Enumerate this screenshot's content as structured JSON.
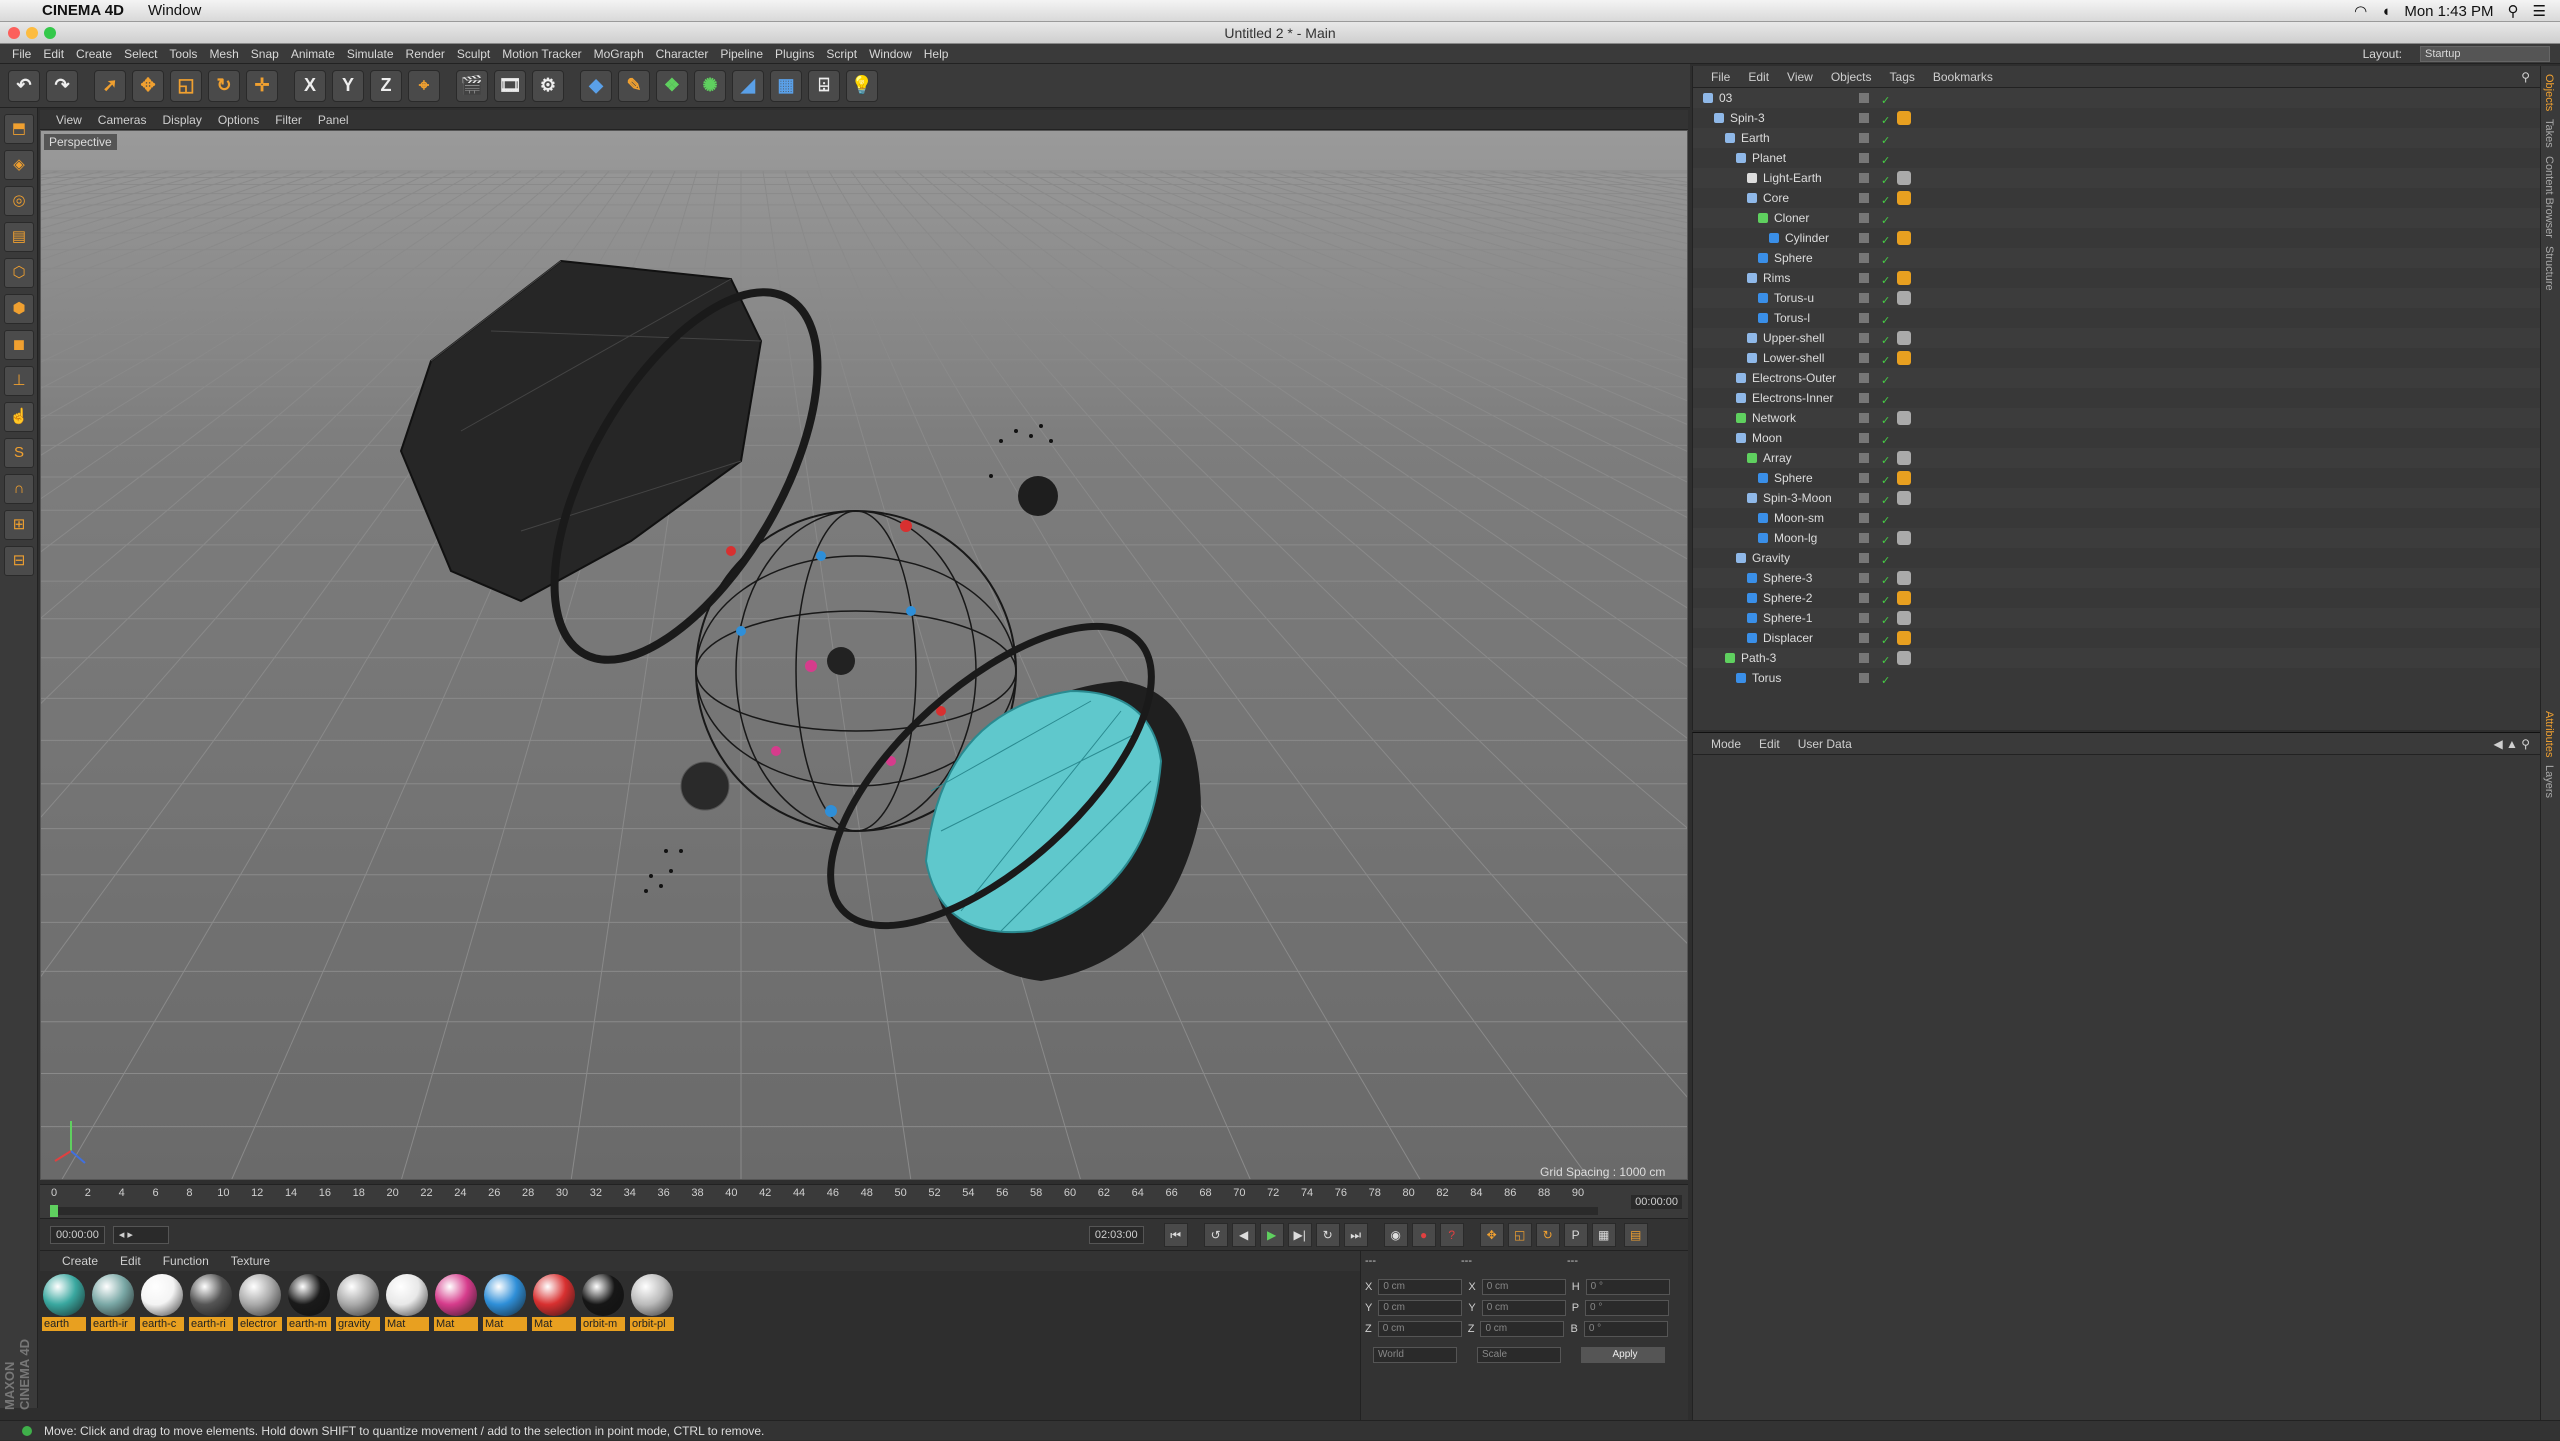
{
  "mac_menubar": {
    "app_name": "CINEMA 4D",
    "menus": [
      "Window"
    ],
    "clock": "Mon 1:43 PM"
  },
  "window": {
    "title": "Untitled 2 * - Main"
  },
  "main_menu": {
    "items": [
      "File",
      "Edit",
      "Create",
      "Select",
      "Tools",
      "Mesh",
      "Snap",
      "Animate",
      "Simulate",
      "Render",
      "Sculpt",
      "Motion Tracker",
      "MoGraph",
      "Character",
      "Pipeline",
      "Plugins",
      "Script",
      "Window",
      "Help"
    ],
    "layout_label": "Layout:",
    "layout_value": "Startup"
  },
  "toolbar": {
    "axis_x": "X",
    "axis_y": "Y",
    "axis_z": "Z"
  },
  "viewport": {
    "menu": [
      "View",
      "Cameras",
      "Display",
      "Options",
      "Filter",
      "Panel"
    ],
    "label": "Perspective",
    "grid_spacing": "Grid Spacing : 1000 cm"
  },
  "timeline": {
    "ticks": [
      "0",
      "2",
      "4",
      "6",
      "8",
      "10",
      "12",
      "14",
      "16",
      "18",
      "20",
      "22",
      "24",
      "26",
      "28",
      "30",
      "32",
      "34",
      "36",
      "38",
      "40",
      "42",
      "44",
      "46",
      "48",
      "50",
      "52",
      "54",
      "56",
      "58",
      "60",
      "62",
      "64",
      "66",
      "68",
      "70",
      "72",
      "74",
      "76",
      "78",
      "80",
      "82",
      "84",
      "86",
      "88",
      "90"
    ],
    "end_field": "00:00:00"
  },
  "transport": {
    "current_time": "00:00:00",
    "end_time": "02:03:00"
  },
  "materials": {
    "menu": [
      "Create",
      "Edit",
      "Function",
      "Texture"
    ],
    "items": [
      {
        "label": "earth",
        "color": "#3aa8a0"
      },
      {
        "label": "earth-ir",
        "color": "#7aa8a6"
      },
      {
        "label": "earth-c",
        "color": "#f4f4f4"
      },
      {
        "label": "earth-ri",
        "color": "#555555"
      },
      {
        "label": "electror",
        "color": "#aaaaaa"
      },
      {
        "label": "earth-m",
        "color": "#1a1a1a"
      },
      {
        "label": "gravity",
        "color": "#aaaaaa"
      },
      {
        "label": "Mat",
        "color": "#e8e8e8"
      },
      {
        "label": "Mat",
        "color": "#d63c8c"
      },
      {
        "label": "Mat",
        "color": "#2f8fd8"
      },
      {
        "label": "Mat",
        "color": "#d83030"
      },
      {
        "label": "orbit-m",
        "color": "#161616"
      },
      {
        "label": "orbit-pl",
        "color": "#bbbbbb"
      }
    ]
  },
  "coordinates": {
    "header": [
      "---",
      "---",
      "---"
    ],
    "rows": [
      {
        "a": "X",
        "av": "0 cm",
        "b": "X",
        "bv": "0 cm",
        "c": "H",
        "cv": "0 °"
      },
      {
        "a": "Y",
        "av": "0 cm",
        "b": "Y",
        "bv": "0 cm",
        "c": "P",
        "cv": "0 °"
      },
      {
        "a": "Z",
        "av": "0 cm",
        "b": "Z",
        "bv": "0 cm",
        "c": "B",
        "cv": "0 °"
      }
    ],
    "mode1": "World",
    "mode2": "Scale",
    "apply": "Apply"
  },
  "object_manager": {
    "menu": [
      "File",
      "Edit",
      "View",
      "Objects",
      "Tags",
      "Bookmarks"
    ],
    "objects": [
      {
        "name": "03",
        "depth": 0,
        "color": "#8fb8e8"
      },
      {
        "name": "Spin-3",
        "depth": 1,
        "color": "#8fb8e8"
      },
      {
        "name": "Earth",
        "depth": 2,
        "color": "#8fb8e8"
      },
      {
        "name": "Planet",
        "depth": 3,
        "color": "#8fb8e8"
      },
      {
        "name": "Light-Earth",
        "depth": 4,
        "color": "#dddddd"
      },
      {
        "name": "Core",
        "depth": 4,
        "color": "#8fb8e8"
      },
      {
        "name": "Cloner",
        "depth": 5,
        "color": "#5fd05f"
      },
      {
        "name": "Cylinder",
        "depth": 6,
        "color": "#3a8fe8"
      },
      {
        "name": "Sphere",
        "depth": 5,
        "color": "#3a8fe8"
      },
      {
        "name": "Rims",
        "depth": 4,
        "color": "#8fb8e8"
      },
      {
        "name": "Torus-u",
        "depth": 5,
        "color": "#3a8fe8"
      },
      {
        "name": "Torus-l",
        "depth": 5,
        "color": "#3a8fe8"
      },
      {
        "name": "Upper-shell",
        "depth": 4,
        "color": "#8fb8e8"
      },
      {
        "name": "Lower-shell",
        "depth": 4,
        "color": "#8fb8e8"
      },
      {
        "name": "Electrons-Outer",
        "depth": 3,
        "color": "#8fb8e8"
      },
      {
        "name": "Electrons-Inner",
        "depth": 3,
        "color": "#8fb8e8"
      },
      {
        "name": "Network",
        "depth": 3,
        "color": "#5fd05f"
      },
      {
        "name": "Moon",
        "depth": 3,
        "color": "#8fb8e8"
      },
      {
        "name": "Array",
        "depth": 4,
        "color": "#5fd05f"
      },
      {
        "name": "Sphere",
        "depth": 5,
        "color": "#3a8fe8"
      },
      {
        "name": "Spin-3-Moon",
        "depth": 4,
        "color": "#8fb8e8"
      },
      {
        "name": "Moon-sm",
        "depth": 5,
        "color": "#3a8fe8"
      },
      {
        "name": "Moon-lg",
        "depth": 5,
        "color": "#3a8fe8"
      },
      {
        "name": "Gravity",
        "depth": 3,
        "color": "#8fb8e8"
      },
      {
        "name": "Sphere-3",
        "depth": 4,
        "color": "#3a8fe8"
      },
      {
        "name": "Sphere-2",
        "depth": 4,
        "color": "#3a8fe8"
      },
      {
        "name": "Sphere-1",
        "depth": 4,
        "color": "#3a8fe8"
      },
      {
        "name": "Displacer",
        "depth": 4,
        "color": "#3a8fe8"
      },
      {
        "name": "Path-3",
        "depth": 2,
        "color": "#5fd05f"
      },
      {
        "name": "Torus",
        "depth": 3,
        "color": "#3a8fe8"
      }
    ]
  },
  "attributes": {
    "menu": [
      "Mode",
      "Edit",
      "User Data"
    ]
  },
  "right_tabs": [
    "Objects",
    "Takes",
    "Content Browser",
    "Structure",
    "Attributes",
    "Layers"
  ],
  "status": {
    "message": "Move: Click and drag to move elements. Hold down SHIFT to quantize movement / add to the selection in point mode, CTRL to remove."
  },
  "branding": {
    "maxon": "MAXON CINEMA 4D"
  }
}
